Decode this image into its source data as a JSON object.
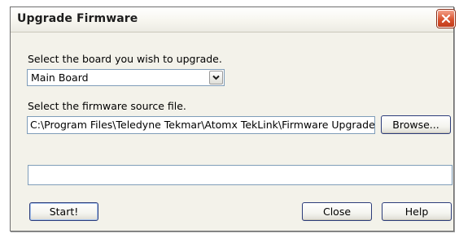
{
  "window": {
    "title": "Upgrade Firmware"
  },
  "board": {
    "prompt": "Select the board you wish to upgrade.",
    "selected": "Main Board"
  },
  "firmware": {
    "prompt": "Select the firmware source file.",
    "path": "C:\\Program Files\\Teledyne Tekmar\\Atomx TekLink\\Firmware Upgrade",
    "browse_label": "Browse..."
  },
  "status": {
    "text": ""
  },
  "buttons": {
    "start": "Start!",
    "close": "Close",
    "help": "Help"
  },
  "icons": {
    "close": "close-icon",
    "dropdown": "chevron-down-icon"
  },
  "colors": {
    "dialog_bg": "#f3f2ea",
    "close_red": "#d8532f",
    "field_border": "#7f9db9"
  }
}
